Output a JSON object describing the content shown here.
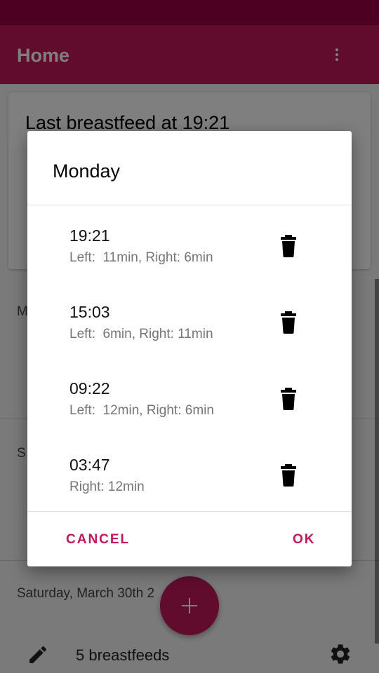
{
  "app_bar": {
    "title": "Home"
  },
  "card": {
    "heading": "Last breastfeed at 19:21"
  },
  "sections": [
    {
      "label": "M"
    },
    {
      "label": "S"
    },
    {
      "label": "Saturday, March 30th 2"
    }
  ],
  "footer": {
    "count_label": "5 breastfeeds"
  },
  "dialog": {
    "title": "Monday",
    "entries": [
      {
        "time": "19:21",
        "detail": "Left:  11min, Right: 6min"
      },
      {
        "time": "15:03",
        "detail": "Left:  6min, Right: 11min"
      },
      {
        "time": "09:22",
        "detail": "Left:  12min, Right: 6min"
      },
      {
        "time": "03:47",
        "detail": "Right: 12min"
      }
    ],
    "cancel_label": "CANCEL",
    "ok_label": "OK"
  },
  "colors": {
    "primary": "#c2185b",
    "status_bar": "#9a0045"
  },
  "icons": {
    "menu": "more-vert-icon",
    "delete": "trash-icon",
    "edit": "pencil-icon",
    "settings": "gear-icon",
    "add": "plus-icon"
  }
}
